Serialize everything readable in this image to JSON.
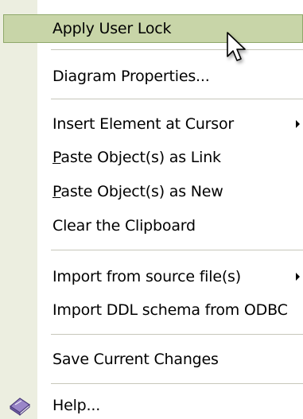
{
  "menu": {
    "items": [
      {
        "label": "Apply User Lock",
        "mnemonic": null,
        "submenu": false,
        "highlighted": true
      },
      {
        "label": "Diagram Properties...",
        "submenu": false
      },
      {
        "label": "Insert Element at Cursor",
        "submenu": true
      },
      {
        "label_mnemonic": "P",
        "label_rest": "aste Object(s) as Link",
        "submenu": false
      },
      {
        "label_mnemonic": "P",
        "label_rest": "aste Object(s) as New",
        "submenu": false
      },
      {
        "label": "Clear the Clipboard",
        "submenu": false
      },
      {
        "label": "Import from source file(s)",
        "submenu": true
      },
      {
        "label": "Import DDL schema from ODBC",
        "submenu": false
      },
      {
        "label": "Save Current Changes",
        "submenu": false
      },
      {
        "label": "Help...",
        "submenu": false,
        "icon": "help-book-icon"
      }
    ]
  },
  "colors": {
    "gutter": "#eceee0",
    "highlight_fill": "#c8d5a8",
    "highlight_border": "#8fa86a",
    "separator": "#c7c7bb"
  }
}
